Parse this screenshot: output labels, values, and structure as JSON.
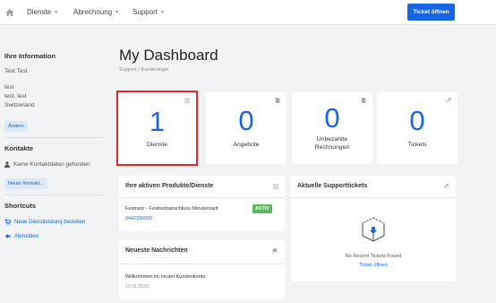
{
  "nav": {
    "items": [
      {
        "label": "Dienste"
      },
      {
        "label": "Abrechnung"
      },
      {
        "label": "Support"
      }
    ],
    "ticket_button": "Ticket öffnen"
  },
  "sidebar": {
    "info_heading": "Ihre Information",
    "name": "Test Test",
    "address_lines": [
      "test",
      "test, test",
      "Switzerland"
    ],
    "edit_button": "Ändern",
    "contacts_heading": "Kontakte",
    "no_contacts": "Keine Kontaktdaten gefunden",
    "new_contact_button": "Neuer Kontakt...",
    "shortcuts_heading": "Shortcuts",
    "shortcut_order": "Neue Dienstleistung bestellen",
    "shortcut_logout": "Abmelden"
  },
  "main": {
    "title": "My Dashboard",
    "breadcrumb": [
      "Support",
      "Kundenlogin"
    ],
    "stats": [
      {
        "value": "1",
        "label": "Dienste"
      },
      {
        "value": "0",
        "label": "Angebote"
      },
      {
        "value": "0",
        "label_lines": [
          "Unbezahlte",
          "Rechnungen"
        ]
      },
      {
        "value": "0",
        "label": "Tickets"
      }
    ],
    "products_panel": {
      "title": "Ihre aktiven Produkte/Dienste",
      "product_name": "Festnetz - Festnetzanschluss Minutentarif",
      "product_number": "0442330000",
      "status": "AKTIV"
    },
    "tickets_panel": {
      "title": "Aktuelle Supporttickets",
      "empty_text": "No Recent Tickets Found",
      "open_link": "Ticket öffnen"
    },
    "news_panel": {
      "title": "Neueste Nachrichten",
      "item_text": "Willkommen im neuen Kundenkonto",
      "item_date": "10.01.2020"
    }
  },
  "colors": {
    "accent": "#1565e6",
    "highlight_border": "#e0262d",
    "status_active": "#5cb85c"
  }
}
